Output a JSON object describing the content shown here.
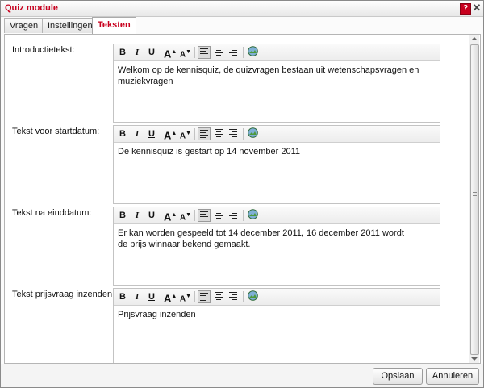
{
  "window": {
    "title": "Quiz module",
    "help_glyph": "?",
    "close_glyph": "✕"
  },
  "tabs": [
    {
      "label": "Vragen",
      "active": false
    },
    {
      "label": "Instellingen",
      "active": false
    },
    {
      "label": "Teksten",
      "active": true
    }
  ],
  "toolbar": {
    "bold": "B",
    "italic": "I",
    "underline": "U",
    "font_increase": "A",
    "font_decrease": "A",
    "align_left": "align-left-icon",
    "align_center": "align-center-icon",
    "align_right": "align-right-icon",
    "image": "image-icon"
  },
  "fields": [
    {
      "label": "Introductietekst:",
      "text": "Welkom op de kennisquiz, de quizvragen bestaan uit wetenschapsvragen en muziekvragen"
    },
    {
      "label": "Tekst voor startdatum:",
      "text": "De kennisquiz is gestart op 14 november 2011"
    },
    {
      "label": "Tekst na einddatum:",
      "text": "Er kan worden gespeeld tot 14 december 2011, 16 december 2011 wordt de prijs winnaar bekend gemaakt."
    },
    {
      "label": "Tekst prijsvraag inzenden:",
      "text": "Prijsvraag inzenden"
    }
  ],
  "buttons": {
    "save": "Opslaan",
    "cancel": "Annuleren"
  },
  "colors": {
    "accent": "#c8001e"
  }
}
